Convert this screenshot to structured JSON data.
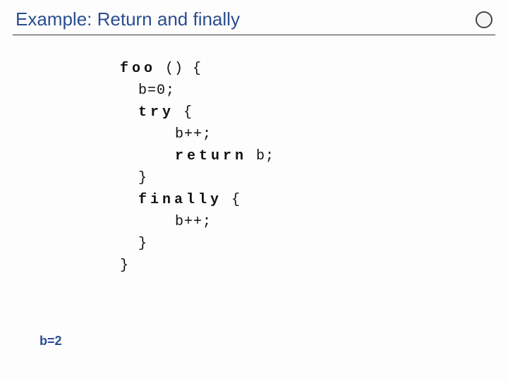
{
  "slide": {
    "title": "Example: Return and finally",
    "logo_text": "",
    "result": "b=2"
  },
  "code": {
    "l1a": "foo",
    "l1b": " () {",
    "l2": "  b=0;",
    "l3a": "  ",
    "l3b": "try",
    "l3c": " {",
    "l4": "      b++;",
    "l5a": "      ",
    "l5b": "return",
    "l5c": " b;",
    "l6": "  }",
    "l7a": "  ",
    "l7b": "finally",
    "l7c": " {",
    "l8": "      b++;",
    "l9": "  }",
    "l10": "}"
  }
}
